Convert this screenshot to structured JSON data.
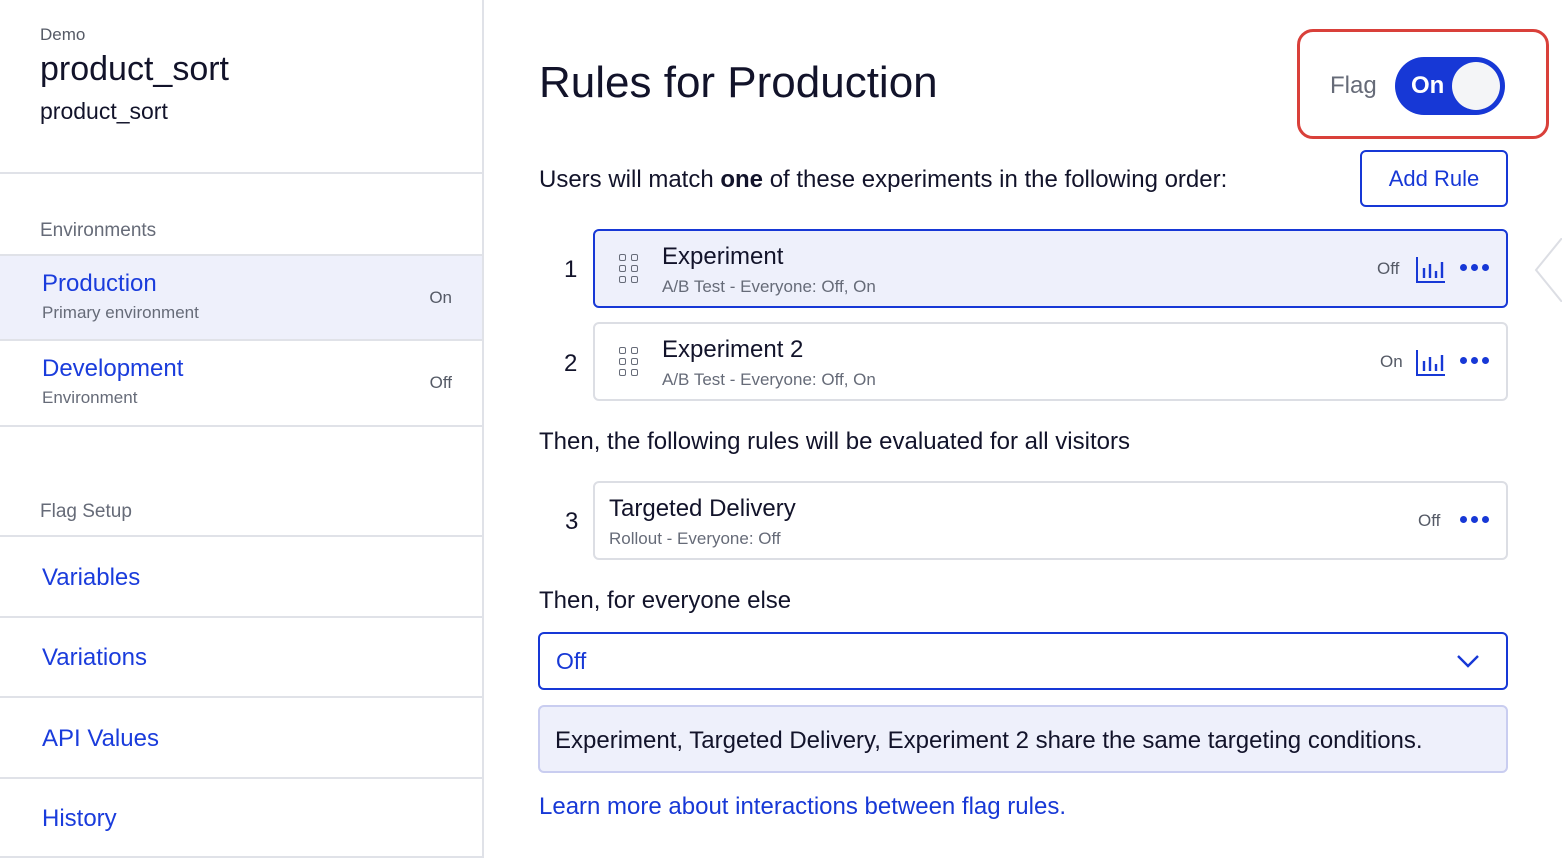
{
  "sidebar": {
    "project_label": "Demo",
    "flag_name": "product_sort",
    "flag_key": "product_sort",
    "environments_label": "Environments",
    "environments": [
      {
        "name": "Production",
        "subtitle": "Primary environment",
        "status": "On"
      },
      {
        "name": "Development",
        "subtitle": "Environment",
        "status": "Off"
      }
    ],
    "setup_label": "Flag Setup",
    "setup_items": [
      "Variables",
      "Variations",
      "API Values",
      "History"
    ]
  },
  "main": {
    "title": "Rules for Production",
    "flag_toggle": {
      "label": "Flag",
      "state": "On"
    },
    "intro_pre": "Users will match ",
    "intro_bold": "one",
    "intro_post": " of these experiments in the following order:",
    "add_rule_label": "Add Rule",
    "experiments": [
      {
        "number": "1",
        "name": "Experiment",
        "description": "A/B Test - Everyone: Off, On",
        "status": "Off",
        "icons": [
          "results-icon",
          "more-icon"
        ]
      },
      {
        "number": "2",
        "name": "Experiment 2",
        "description": "A/B Test - Everyone: Off, On",
        "status": "On",
        "icons": [
          "results-icon",
          "more-icon"
        ]
      }
    ],
    "then_rules_text": "Then, the following rules will be evaluated for all visitors",
    "rules": [
      {
        "number": "3",
        "name": "Targeted Delivery",
        "description": "Rollout - Everyone: Off",
        "status": "Off",
        "icons": [
          "more-icon"
        ]
      }
    ],
    "then_everyone_text": "Then, for everyone else",
    "fallback_value": "Off",
    "notice": "Experiment, Targeted Delivery, Experiment 2 share the same targeting conditions.",
    "learn_more": "Learn more about interactions between flag rules."
  },
  "colors": {
    "accent": "#1738d6",
    "highlight": "#d9403a",
    "selected_bg": "#eef0fb"
  }
}
